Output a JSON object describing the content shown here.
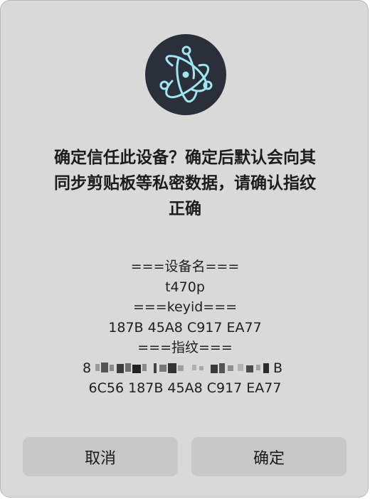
{
  "app_icon": "electron-atom-icon",
  "colors": {
    "dialog_bg": "#d9d9d9",
    "button_bg": "#c8c8c8",
    "icon_bg": "#2b2f3a",
    "icon_stroke": "#9fe6f2"
  },
  "prompt": {
    "line1": "确定信任此设备？确定后默认会向其",
    "line2": "同步剪贴板等私密数据，请确认指纹",
    "line3": "正确"
  },
  "details": {
    "device_name_header": "===设备名===",
    "device_name": "t470p",
    "keyid_header": "===keyid===",
    "keyid": "187B 45A8 C917 EA77",
    "fingerprint_header": "===指纹===",
    "fingerprint_first_char": "8",
    "fingerprint_last_char": "B",
    "fingerprint_line2": "6C56 187B 45A8 C917 EA77"
  },
  "buttons": {
    "cancel": "取消",
    "confirm": "确定"
  }
}
